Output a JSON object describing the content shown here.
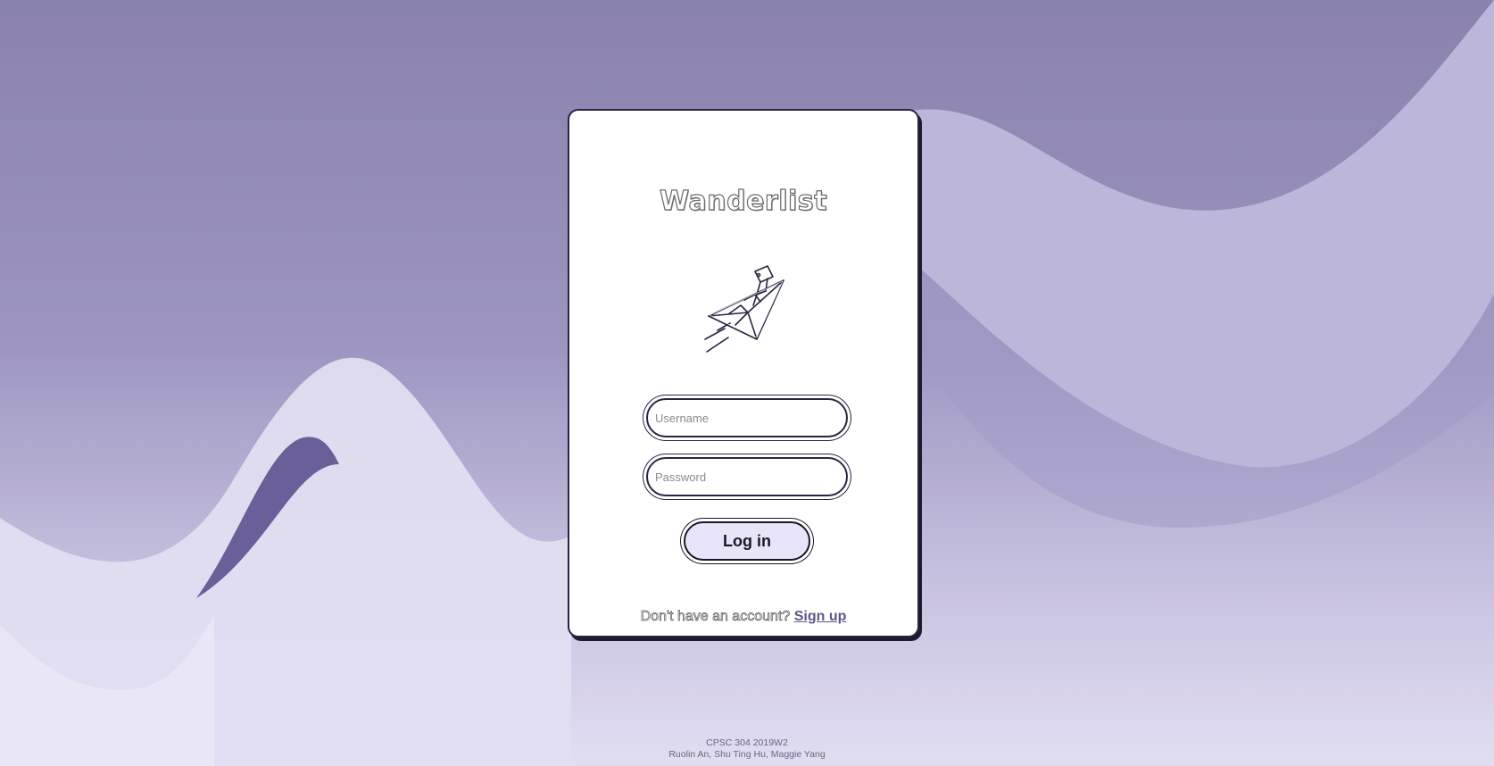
{
  "app": {
    "title": "Wanderlist",
    "logo_icon": "paper-plane-icon"
  },
  "login_form": {
    "username_placeholder": "Username",
    "password_placeholder": "Password",
    "username_value": "",
    "password_value": "",
    "login_label": "Log in"
  },
  "signup": {
    "prompt": "Don't have an account?",
    "link_label": "Sign up"
  },
  "footer": {
    "course": "CPSC 304 2019W2",
    "authors": "Ruolin An, Shu Ting Hu, Maggie Yang"
  },
  "colors": {
    "background_top": "#8a82ad",
    "background_bottom": "#e2def1",
    "wave_light": "#e2def1",
    "wave_mid": "#b8b2d6",
    "wave_dark": "#6a5f98",
    "button_fill": "#e8e5fa",
    "card": "#ffffff"
  }
}
